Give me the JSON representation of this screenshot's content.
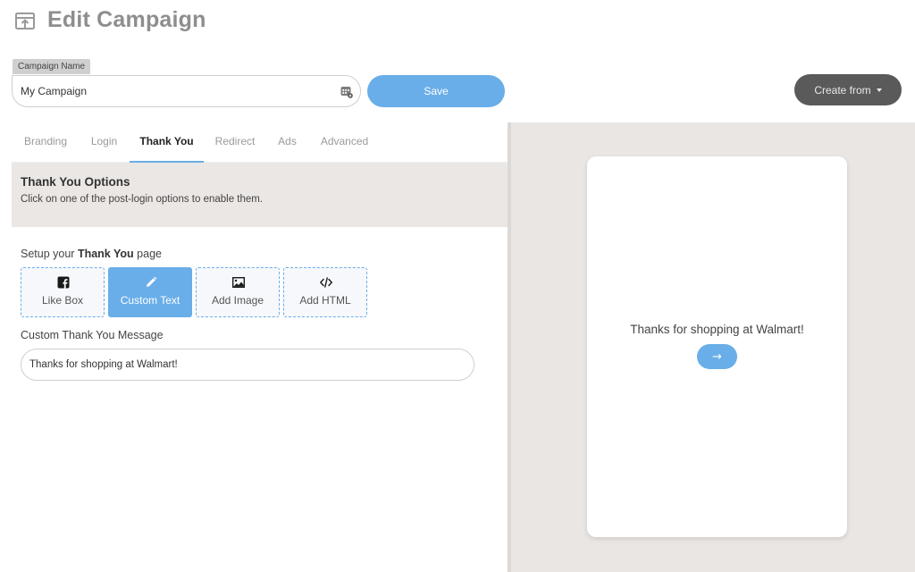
{
  "header": {
    "title": "Edit Campaign",
    "icon": "upload-box-icon"
  },
  "campaign": {
    "label": "Campaign Name",
    "value": "My Campaign",
    "save_label": "Save",
    "create_from_label": "Create from"
  },
  "tabs": [
    {
      "label": "Branding"
    },
    {
      "label": "Login"
    },
    {
      "label": "Thank You",
      "active": true
    },
    {
      "label": "Redirect"
    },
    {
      "label": "Ads"
    },
    {
      "label": "Advanced"
    }
  ],
  "options": {
    "title": "Thank You Options",
    "description": "Click on one of the post-login options to enable them."
  },
  "setup": {
    "prefix": "Setup your ",
    "bold": "Thank You",
    "suffix": " page"
  },
  "option_buttons": [
    {
      "label": "Like Box",
      "icon": "facebook-icon",
      "active": false
    },
    {
      "label": "Custom Text",
      "icon": "pencil-icon",
      "active": true
    },
    {
      "label": "Add Image",
      "icon": "image-icon",
      "active": false
    },
    {
      "label": "Add HTML",
      "icon": "code-icon",
      "active": false
    }
  ],
  "message": {
    "label": "Custom Thank You Message",
    "value": "Thanks for shopping at Walmart!"
  },
  "preview": {
    "text": "Thanks for shopping at Walmart!",
    "arrow": "→"
  },
  "colors": {
    "accent": "#69aee8",
    "dark_button": "#5a5a5a",
    "banner_bg": "#ebe7e4",
    "preview_bg": "#eae6e3"
  }
}
